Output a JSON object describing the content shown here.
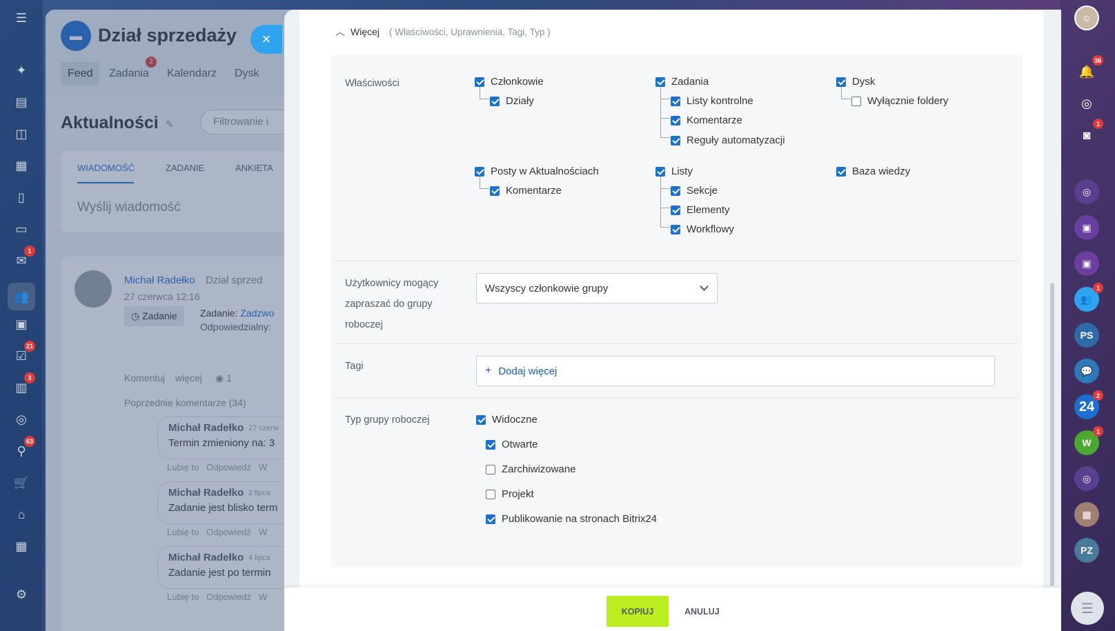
{
  "left_nav": {
    "badges": [
      "1",
      "21",
      "3",
      "63"
    ]
  },
  "background": {
    "group_title": "Dział sprzedaży",
    "tabs": [
      "Feed",
      "Zadania",
      "Kalendarz",
      "Dysk"
    ],
    "tasks_badge": "2",
    "feed_title": "Aktualności",
    "filter_placeholder": "Filtrowanie i",
    "post_tabs": [
      "WIADOMOŚĆ",
      "ZADANIE",
      "ANKIETA"
    ],
    "send_placeholder": "Wyślij wiadomość",
    "post_author": "Michał Radełko",
    "post_target": "Dział sprzed",
    "post_date": "27 czerwca 12:16",
    "task_chip": "Zadanie",
    "task_label": "Zadanie:",
    "task_name": "Zadzwo",
    "responsible": "Odpowiedzialny:",
    "comment_action": "Komentuj",
    "more_action": "więcej",
    "views": "1",
    "previous_comments": "Poprzednie komentarze (34)",
    "comments": [
      {
        "author": "Michał Radełko",
        "date": "27 czerw",
        "text": "Termin zmieniony na: 3"
      },
      {
        "author": "Michał Radełko",
        "date": "2 lipca",
        "text": "Zadanie jest blisko term"
      },
      {
        "author": "Michał Radełko",
        "date": "4 lipca",
        "text": "Zadanie jest po termin"
      }
    ],
    "comment_like": "Lubię to",
    "comment_reply": "Odpowiedź",
    "comment_more": "W"
  },
  "right_bar": {
    "notif_badge": "36",
    "chat_badge": "1",
    "users_badge": "1",
    "avatar_ps": "PS",
    "b24_label": "24",
    "b24_badge": "2",
    "w_label": "W",
    "w_badge": "1",
    "avatar_pz": "PZ"
  },
  "panel": {
    "more_label": "Więcej",
    "more_hint": "( Właściwości, Uprawnienia, Tagi, Typ )",
    "properties_label": "Właściwości",
    "properties": {
      "members": "Członkowie",
      "departments": "Działy",
      "tasks": "Zadania",
      "checklists": "Listy kontrolne",
      "task_comments": "Komentarze",
      "automation": "Reguły automatyzacji",
      "disk": "Dysk",
      "folders_only": "Wyłącznie foldery",
      "feed_posts": "Posty w Aktualnościach",
      "feed_comments": "Komentarze",
      "lists": "Listy",
      "sections": "Sekcje",
      "elements": "Elementy",
      "workflows": "Workflowy",
      "knowledge_base": "Baza wiedzy"
    },
    "invite_label": "Użytkownicy mogący zapraszać do grupy roboczej",
    "invite_value": "Wszyscy członkowie grupy",
    "tags_label": "Tagi",
    "tags_add": "Dodaj więcej",
    "type_label": "Typ grupy roboczej",
    "types": {
      "visible": "Widoczne",
      "open": "Otwarte",
      "archived": "Zarchiwizowane",
      "project": "Projekt",
      "publish": "Publikowanie na stronach Bitrix24"
    },
    "copy_button": "KOPIUJ",
    "cancel_button": "ANULUJ"
  }
}
